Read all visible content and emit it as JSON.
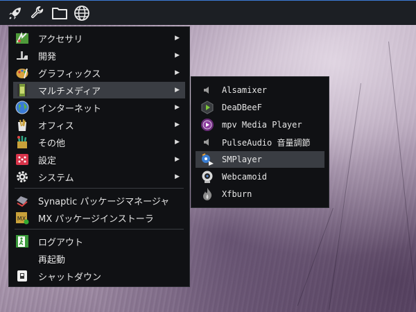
{
  "panel": {
    "icons": [
      "rocket-icon",
      "wrench-icon",
      "folder-icon",
      "globe-icon"
    ]
  },
  "main_menu": {
    "items": [
      {
        "label": "アクセサリ",
        "icon": "accessories-icon",
        "has_submenu": true
      },
      {
        "label": "開発",
        "icon": "development-icon",
        "has_submenu": true
      },
      {
        "label": "グラフィックス",
        "icon": "graphics-icon",
        "has_submenu": true
      },
      {
        "label": "マルチメディア",
        "icon": "multimedia-icon",
        "has_submenu": true,
        "active": true
      },
      {
        "label": "インターネット",
        "icon": "internet-icon",
        "has_submenu": true
      },
      {
        "label": "オフィス",
        "icon": "office-icon",
        "has_submenu": true
      },
      {
        "label": "その他",
        "icon": "other-icon",
        "has_submenu": true
      },
      {
        "label": "設定",
        "icon": "settings-icon",
        "has_submenu": true
      },
      {
        "label": "システム",
        "icon": "system-gear-icon",
        "has_submenu": true
      },
      {
        "label": "Synaptic パッケージマネージャ",
        "icon": "synaptic-icon",
        "has_submenu": false
      },
      {
        "label": "MX パッケージインストーラ",
        "icon": "mx-installer-icon",
        "has_submenu": false
      },
      {
        "label": "ログアウト",
        "icon": "logout-icon",
        "has_submenu": false
      },
      {
        "label": "再起動",
        "icon": "",
        "has_submenu": false
      },
      {
        "label": "シャットダウン",
        "icon": "shutdown-icon",
        "has_submenu": false
      }
    ]
  },
  "sub_menu": {
    "items": [
      {
        "label": "Alsamixer",
        "icon": "speaker-icon"
      },
      {
        "label": "DeaDBeeF",
        "icon": "deadbeef-icon"
      },
      {
        "label": "mpv Media Player",
        "icon": "mpv-icon"
      },
      {
        "label": "PulseAudio 音量調節",
        "icon": "speaker-icon"
      },
      {
        "label": "SMPlayer",
        "icon": "smplayer-icon",
        "active": true
      },
      {
        "label": "Webcamoid",
        "icon": "webcam-icon"
      },
      {
        "label": "Xfburn",
        "icon": "xfburn-icon"
      }
    ]
  },
  "arrow_glyph": "▶",
  "colors": {
    "panel_bg": "#1c1f24",
    "panel_accent": "#3c7bd8",
    "menu_bg": "#101114",
    "highlight": "#3a3d43",
    "text": "#e6e6e6"
  }
}
